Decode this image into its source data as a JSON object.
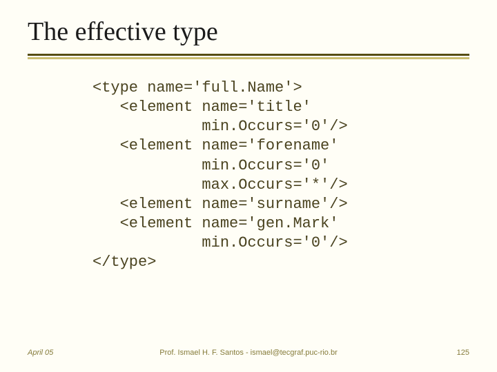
{
  "title": "The effective type",
  "code": {
    "l1": "<type name='full.Name'>",
    "l2": "   <element name='title'",
    "l3": "            min.Occurs='0'/>",
    "l4": "   <element name='forename'",
    "l5": "            min.Occurs='0'",
    "l6": "            max.Occurs='*'/>",
    "l7": "   <element name='surname'/>",
    "l8": "   <element name='gen.Mark'",
    "l9": "            min.Occurs='0'/>",
    "l10": "</type>"
  },
  "footer": {
    "date": "April 05",
    "center": "Prof. Ismael H. F. Santos - ismael@tecgraf.puc-rio.br",
    "page": "125"
  }
}
